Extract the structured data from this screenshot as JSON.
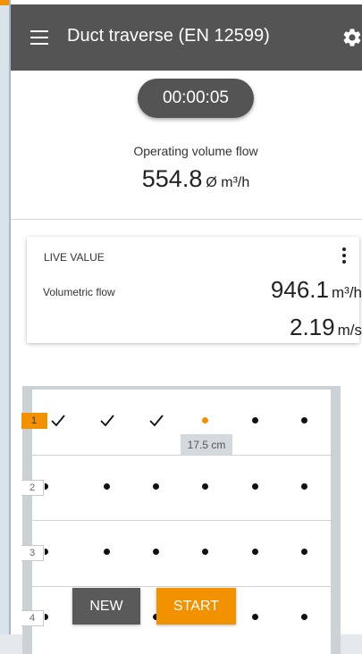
{
  "colors": {
    "accent": "#f39200",
    "toolbar": "#545454",
    "background": "#ffffff"
  },
  "appbar": {
    "title": "Duct traverse (EN 12599)",
    "menu_icon": "hamburger-menu-icon",
    "settings_icon": "gear-icon"
  },
  "timer": "00:00:05",
  "operating": {
    "label": "Operating volume flow",
    "value": "554.8",
    "unit": "Ø m³/h"
  },
  "live": {
    "title": "LIVE VALUE",
    "more_icon": "more-vertical-icon",
    "name": "Volumetric flow",
    "values": [
      {
        "num": "946.1",
        "unit": "m³/h"
      },
      {
        "num": "2.19",
        "unit": "m/s"
      }
    ]
  },
  "traverse": {
    "rows": [
      {
        "label": "1",
        "active": true,
        "points": [
          "done",
          "done",
          "done",
          "current",
          "pending",
          "pending"
        ]
      },
      {
        "label": "2",
        "active": false,
        "points": [
          "pending",
          "pending",
          "pending",
          "pending",
          "pending",
          "pending"
        ]
      },
      {
        "label": "3",
        "active": false,
        "points": [
          "pending",
          "pending",
          "pending",
          "pending",
          "pending",
          "pending"
        ]
      },
      {
        "label": "4",
        "active": false,
        "points": [
          "pending",
          "pending",
          "pending",
          "pending",
          "pending",
          "pending"
        ]
      }
    ],
    "tooltip": "17.5 cm"
  },
  "buttons": {
    "new": "NEW",
    "start": "START"
  }
}
